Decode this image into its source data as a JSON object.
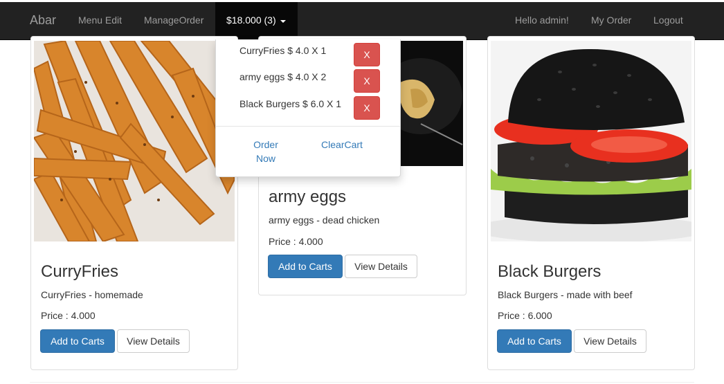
{
  "navbar": {
    "brand": "Abar",
    "links": {
      "menu_edit": "Menu Edit",
      "manage_order": "ManageOrder"
    },
    "cart_label": "$18.000 (3)",
    "greeting": "Hello admin!",
    "my_order": "My Order",
    "logout": "Logout",
    "bg_color": "#222222"
  },
  "cart_dropdown": {
    "items": [
      {
        "text": "CurryFries $ 4.0 X 1",
        "remove_label": "X"
      },
      {
        "text": "army eggs $ 4.0 X 2",
        "remove_label": "X"
      },
      {
        "text": "Black Burgers $ 6.0 X 1",
        "remove_label": "X"
      }
    ],
    "order_now": "Order Now",
    "clear_cart": "ClearCart"
  },
  "products": [
    {
      "name": "CurryFries",
      "description": "CurryFries - homemade",
      "price": "Price : 4.000",
      "add_label": "Add to Carts",
      "details_label": "View Details"
    },
    {
      "name": "army eggs",
      "description": "army eggs - dead chicken",
      "price": "Price : 4.000",
      "add_label": "Add to Carts",
      "details_label": "View Details"
    },
    {
      "name": "Black Burgers",
      "description": "Black Burgers - made with beef",
      "price": "Price : 6.000",
      "add_label": "Add to Carts",
      "details_label": "View Details"
    }
  ],
  "colors": {
    "primary": "#337ab7",
    "danger": "#d9534f",
    "link": "#337ab7"
  }
}
